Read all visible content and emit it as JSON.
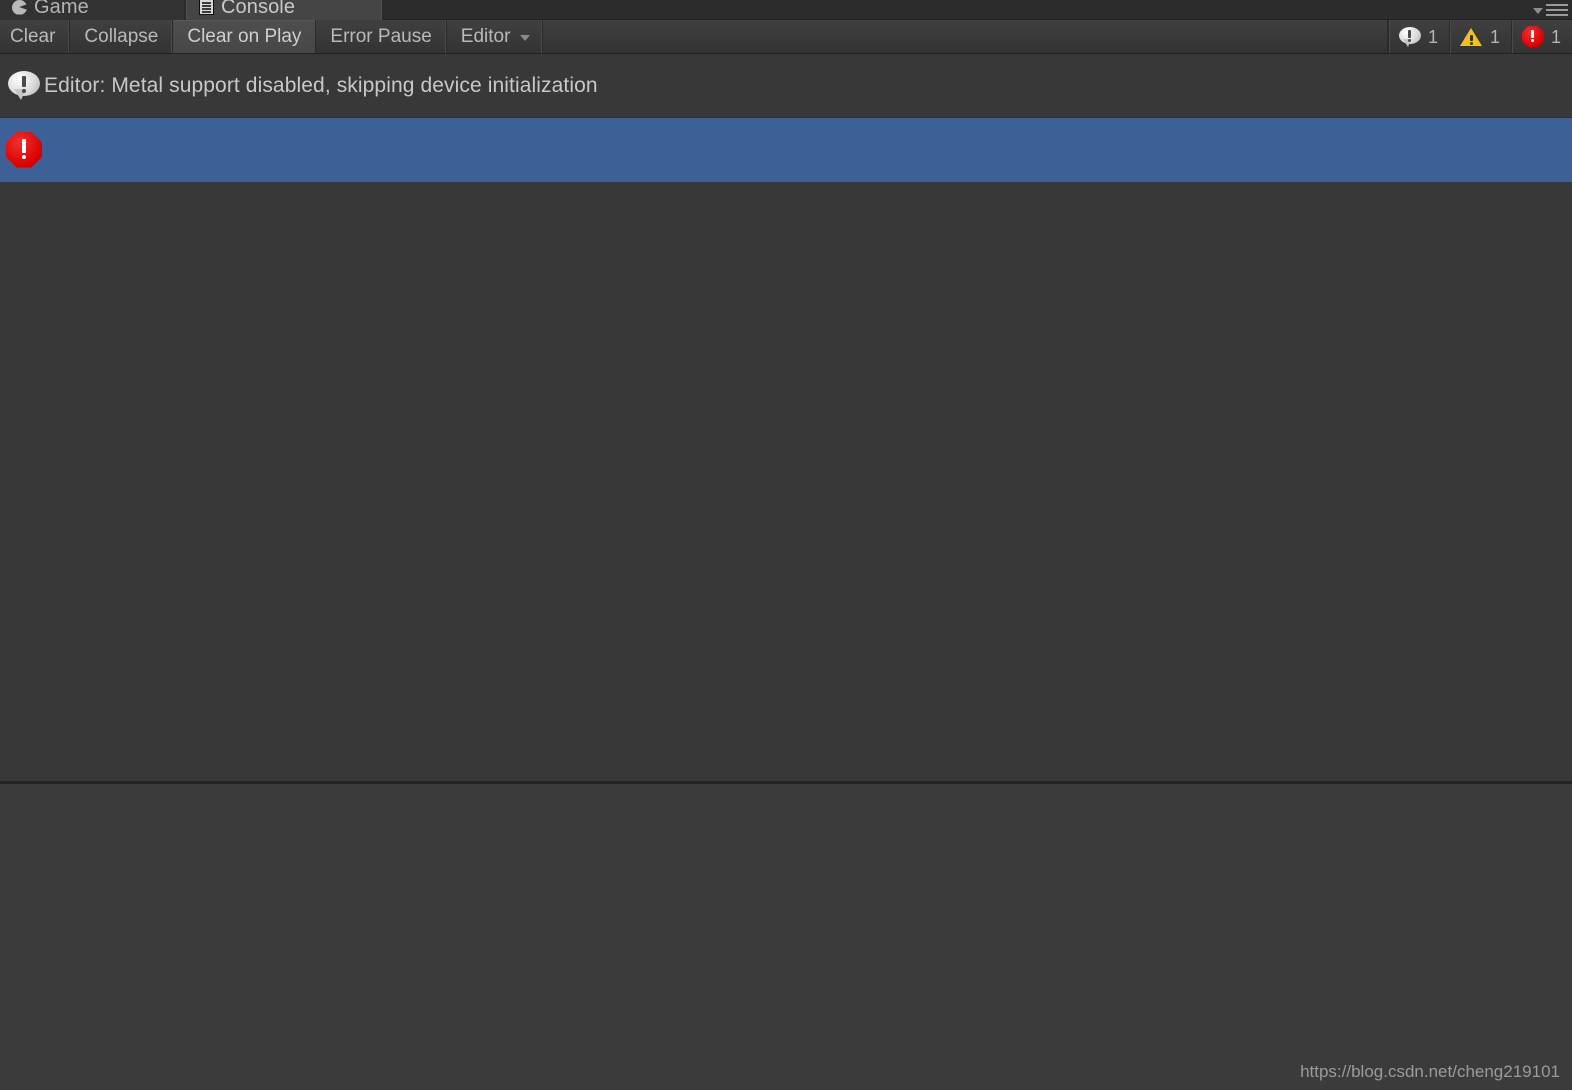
{
  "window": {
    "title": "Console",
    "menu_icon": "hamburger-menu-icon",
    "caret_icon": "chevron-down-icon"
  },
  "tabs": [
    {
      "label": "Game",
      "icon": "game-view-icon",
      "active": false
    },
    {
      "label": "Console",
      "icon": "console-view-icon",
      "active": true
    }
  ],
  "toolbar": {
    "clear_label": "Clear",
    "collapse_label": "Collapse",
    "clear_on_play_label": "Clear on Play",
    "error_pause_label": "Error Pause",
    "editor_label": "Editor",
    "editor_caret_icon": "chevron-down-icon",
    "pressed_button": "Clear on Play"
  },
  "counters": [
    {
      "type": "info",
      "icon": "info-bubble-icon",
      "count": "1"
    },
    {
      "type": "warning",
      "icon": "warning-triangle-icon",
      "count": "1"
    },
    {
      "type": "error",
      "icon": "error-octagon-icon",
      "count": "1"
    }
  ],
  "log_entries": [
    {
      "icon": "info-bubble-icon",
      "type": "info",
      "message": "Editor: Metal support disabled, skipping device initialization",
      "selected": false
    },
    {
      "icon": "error-octagon-icon",
      "type": "error",
      "message": "",
      "selected": true
    }
  ],
  "detail_pane": {
    "text": ""
  },
  "watermark": {
    "text": "https://blog.csdn.net/cheng219101"
  },
  "colors": {
    "window_bg": "#383838",
    "toolbar_top": "#404040",
    "toolbar_bottom": "#333333",
    "selection_blue": "#3d6097",
    "error_red": "#d70000",
    "warning_yellow": "#f2c21a",
    "text": "#c8c8c8"
  }
}
